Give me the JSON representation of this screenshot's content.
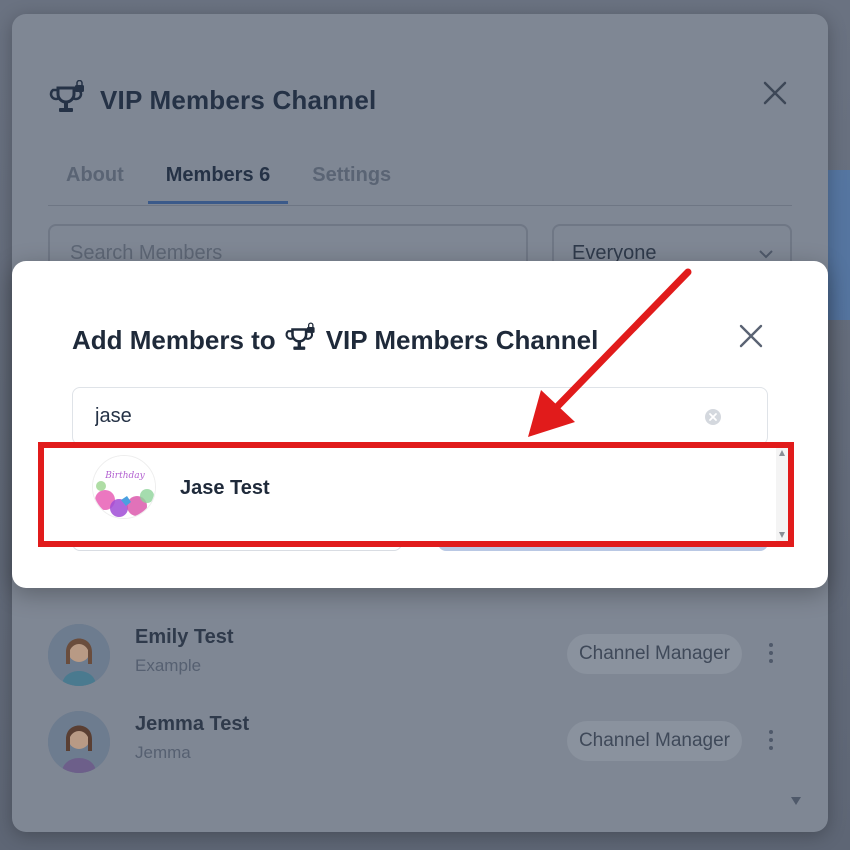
{
  "back_panel": {
    "title": "VIP Members Channel",
    "tabs": [
      {
        "label": "About",
        "active": false
      },
      {
        "label": "Members 6",
        "active": true
      },
      {
        "label": "Settings",
        "active": false
      }
    ],
    "search_placeholder": "Search Members",
    "filter_value": "Everyone",
    "members": [
      {
        "name": "Emily Test",
        "subtitle": "Example",
        "role": "Channel Manager"
      },
      {
        "name": "Jemma Test",
        "subtitle": "Jemma",
        "role": "Channel Manager"
      }
    ]
  },
  "modal": {
    "title_prefix": "Add Members to",
    "title_channel": "VIP Members Channel",
    "search_value": "jase",
    "results": [
      {
        "name": "Jase Test",
        "avatar_text": "Birthday"
      }
    ]
  },
  "colors": {
    "highlight": "#e11b1b",
    "modal_bg": "#ffffff",
    "overlay": "#5f6877",
    "primary_button": "#b9c8e4"
  }
}
